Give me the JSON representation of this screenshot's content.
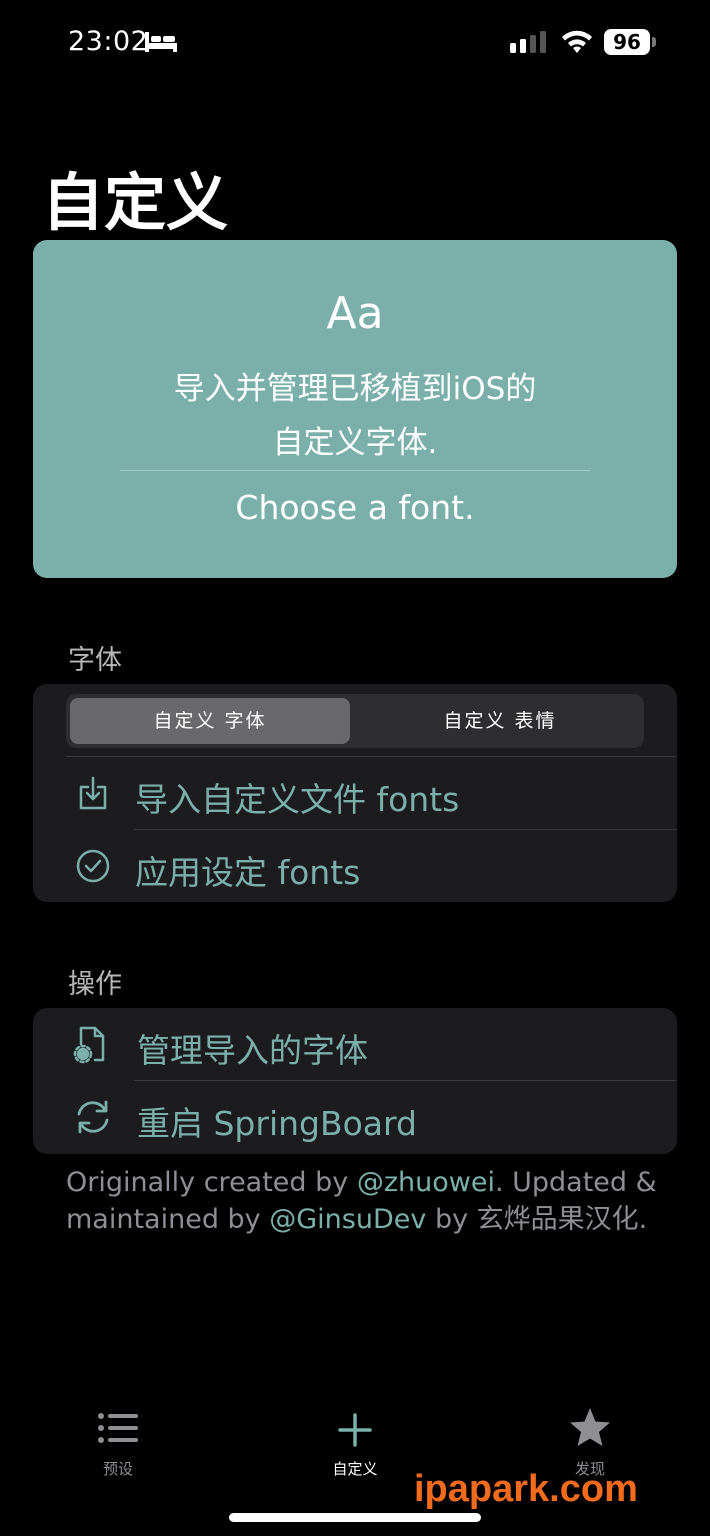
{
  "status_bar": {
    "time": "23:02",
    "battery": "96"
  },
  "page": {
    "title": "自定义"
  },
  "hero": {
    "sample": "Aa",
    "description_line1": "导入并管理已移植到iOS的",
    "description_line2": "自定义字体.",
    "choose": "Choose a font."
  },
  "fonts_section": {
    "header": "字体",
    "segments": [
      "自定义 字体",
      "自定义 表情"
    ],
    "rows": [
      {
        "label": "导入自定义文件 fonts",
        "icon": "import-icon"
      },
      {
        "label": "应用设定 fonts",
        "icon": "checkmark-circle-icon"
      }
    ]
  },
  "actions_section": {
    "header": "操作",
    "rows": [
      {
        "label": "管理导入的字体",
        "icon": "document-gear-icon"
      },
      {
        "label": "重启 SpringBoard",
        "icon": "refresh-icon"
      }
    ]
  },
  "footer": {
    "prefix": "Originally created by ",
    "author": "@zhuowei",
    "middle": ". Updated & maintained by ",
    "maintainer": "@GinsuDev",
    "suffix": " by 玄烨品果汉化."
  },
  "tab_bar": {
    "tabs": [
      {
        "label": "预设",
        "icon": "list-icon"
      },
      {
        "label": "自定义",
        "icon": "plus-icon"
      },
      {
        "label": "发现",
        "icon": "star-icon"
      }
    ]
  },
  "watermark": "ipapark.com",
  "colors": {
    "accent": "#7aafaa",
    "background": "#000000",
    "group": "#1c1c1e"
  }
}
